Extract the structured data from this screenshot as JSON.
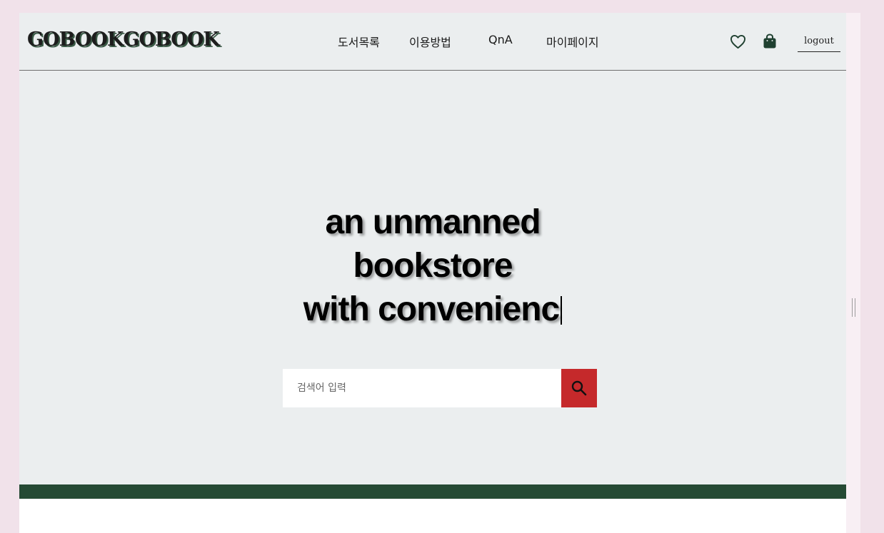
{
  "header": {
    "logo": "GOBOOKGOBOOK",
    "nav": [
      "도서목록",
      "이용방법",
      "QnA",
      "마이페이지"
    ],
    "icons": {
      "wishlist": "heart-icon",
      "cart": "shopping-bag-icon"
    },
    "logout_label": "logout"
  },
  "hero": {
    "lines": [
      "an unmanned",
      "bookstore",
      "with convenienc"
    ]
  },
  "search": {
    "placeholder": "검색어 입력",
    "value": "",
    "button_icon": "search-icon",
    "button_color": "#c5292b"
  },
  "colors": {
    "page_background": "#ebeeef",
    "footer_band": "#254a34",
    "outer_background": "#f1e2ea"
  }
}
